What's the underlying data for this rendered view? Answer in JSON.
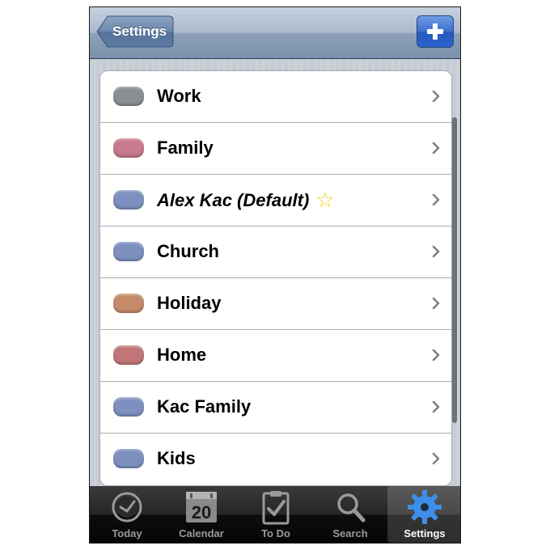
{
  "navbar": {
    "back_label": "Settings"
  },
  "categories": [
    {
      "label": "Work",
      "color": "#8a8f95",
      "italic": false
    },
    {
      "label": "Family",
      "color": "#c77a8e",
      "italic": false
    },
    {
      "label": "Alex Kac (Default)",
      "color": "#7d90bf",
      "italic": true,
      "star": "☆"
    },
    {
      "label": "Church",
      "color": "#7d90bf",
      "italic": false
    },
    {
      "label": "Holiday",
      "color": "#c48a6a",
      "italic": false
    },
    {
      "label": "Home",
      "color": "#c07676",
      "italic": false
    },
    {
      "label": "Kac Family",
      "color": "#7d90bf",
      "italic": false
    },
    {
      "label": "Kids",
      "color": "#7d90bf",
      "italic": false
    }
  ],
  "tabbar": {
    "tabs": [
      {
        "label": "Today",
        "icon": "clock-icon",
        "active": false
      },
      {
        "label": "Calendar",
        "icon": "calendar-icon",
        "active": false,
        "date": "20"
      },
      {
        "label": "To Do",
        "icon": "clipboard-check-icon",
        "active": false
      },
      {
        "label": "Search",
        "icon": "magnifier-icon",
        "active": false
      },
      {
        "label": "Settings",
        "icon": "gear-icon",
        "active": true
      }
    ]
  },
  "colors": {
    "accent": "#2a63cf",
    "active_tab_icon": "#3d8ee8"
  }
}
